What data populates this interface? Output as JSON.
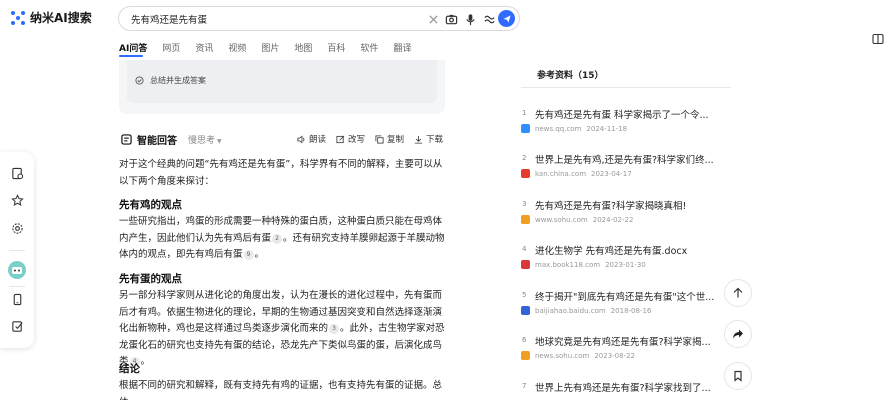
{
  "app": {
    "name": "纳米AI搜索"
  },
  "search": {
    "query": "先有鸡还是先有蛋"
  },
  "tabs": [
    {
      "label": "AI问答",
      "active": true
    },
    {
      "label": "网页"
    },
    {
      "label": "资讯"
    },
    {
      "label": "视频"
    },
    {
      "label": "图片"
    },
    {
      "label": "地图"
    },
    {
      "label": "百科"
    },
    {
      "label": "软件"
    },
    {
      "label": "翻译"
    }
  ],
  "summary": {
    "step_label": "总结并生成答案"
  },
  "answer": {
    "title": "智能回答",
    "mode": "慢思考",
    "actions": {
      "read": "朗读",
      "rewrite": "改写",
      "copy": "复制",
      "download": "下载"
    },
    "intro": "对于这个经典的问题“先有鸡还是先有蛋”，科学界有不同的解释，主要可以从以下两个角度来探讨：",
    "sections": [
      {
        "heading": "先有鸡的观点",
        "p1": "一些研究指出，鸡蛋的形成需要一种特殊的蛋白质，这种蛋白质只能在母鸡体内产生，因此他们认为先有鸡后有蛋",
        "c1": "2",
        "p2": "。还有研究支持羊膜卵起源于羊膜动物体内的观点，即先有鸡后有蛋",
        "c2": "9",
        "p3": "。"
      },
      {
        "heading": "先有蛋的观点",
        "p1": "另一部分科学家则从进化论的角度出发，认为在漫长的进化过程中，先有蛋而后才有鸡。依据生物进化的理论，早期的生物通过基因突变和自然选择逐渐演化出新物种，鸡也是这样通过鸟类逐步演化而来的",
        "c1": "3",
        "p2": "。此外，古生物学家对恐龙蛋化石的研究也支持先有蛋的结论，恐龙先产下类似鸟蛋的蛋，后演化成鸟类",
        "c2": "4",
        "p3": "。"
      },
      {
        "heading": "结论",
        "p1": "根据不同的研究和解释，既有支持先有鸡的证据，也有支持先有蛋的证据。总体"
      }
    ]
  },
  "references": {
    "title": "参考资料（15）",
    "items": [
      {
        "num": "1",
        "title": "先有鸡还是先有蛋 科学家揭示了一个令...",
        "source": "news.qq.com",
        "date": "2024-11-18",
        "color": "#2f8fff"
      },
      {
        "num": "2",
        "title": "世界上是先有鸡,还是先有蛋?科学家们终...",
        "source": "kan.china.com",
        "date": "2023-04-17",
        "color": "#e63c2f"
      },
      {
        "num": "3",
        "title": "先有鸡还是先有蛋?科学家揭晓真相!",
        "source": "www.sohu.com",
        "date": "2024-02-22",
        "color": "#f0a020"
      },
      {
        "num": "4",
        "title": "进化生物学 先有鸡还是先有蛋.docx",
        "source": "max.book118.com",
        "date": "2023-01-30",
        "color": "#d8383a"
      },
      {
        "num": "5",
        "title": "终于揭开\"到底先有鸡还是先有蛋\"这个世...",
        "source": "baijiahao.baidu.com",
        "date": "2018-08-16",
        "color": "#3264d8"
      },
      {
        "num": "6",
        "title": "地球究竟是先有鸡还是先有蛋?科学家揭...",
        "source": "news.sohu.com",
        "date": "2023-08-22",
        "color": "#f0a020"
      },
      {
        "num": "7",
        "title": "世界上先有鸡还是先有蛋?科学家找到了...",
        "source": "",
        "date": "",
        "color": "#e63c2f"
      }
    ]
  },
  "colors": {
    "accent": "#2f6bff"
  }
}
